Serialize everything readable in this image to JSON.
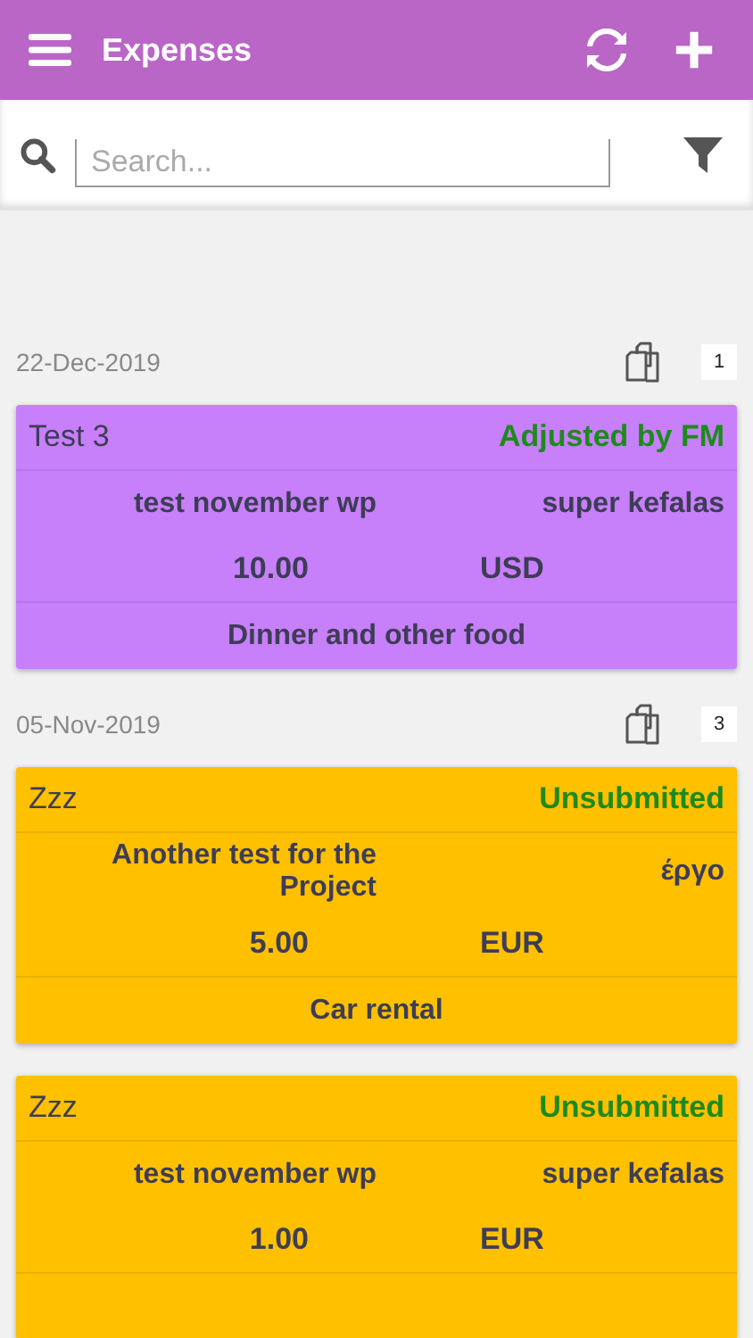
{
  "app_bar": {
    "title": "Expenses"
  },
  "search": {
    "placeholder": "Search..."
  },
  "groups": [
    {
      "date": "22-Dec-2019",
      "count": "1",
      "expenses": [
        {
          "name": "Test 3",
          "status": "Adjusted by FM",
          "project": "test november wp",
          "client": "super kefalas",
          "amount": "10.00",
          "currency": "USD",
          "category": "Dinner and other food",
          "color": "#c77ffa"
        }
      ]
    },
    {
      "date": "05-Nov-2019",
      "count": "3",
      "expenses": [
        {
          "name": "Zzz",
          "status": "Unsubmitted",
          "project": "Another test for the Project",
          "client": "έργο",
          "amount": "5.00",
          "currency": "EUR",
          "category": "Car rental",
          "color": "#ffc000"
        },
        {
          "name": "Zzz",
          "status": "Unsubmitted",
          "project": "test november wp",
          "client": "super kefalas",
          "amount": "1.00",
          "currency": "EUR",
          "color": "#ffc000"
        }
      ]
    }
  ]
}
